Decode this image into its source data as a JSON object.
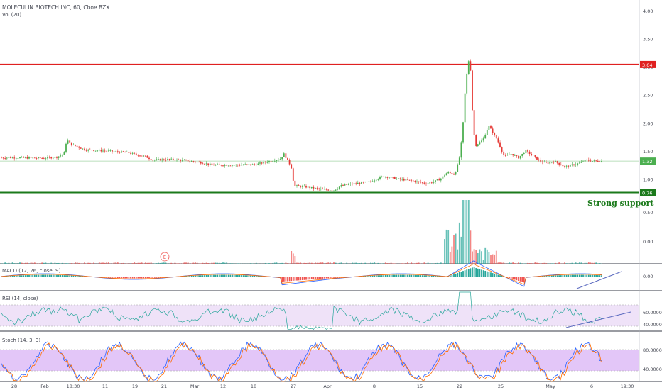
{
  "header": {
    "symbol_line": "MOLECULIN BIOTECH INC, 60, Cboe BZX",
    "volume_label": "Vol (20)",
    "macd_label": "MACD (12, 26, close, 9)",
    "rsi_label": "RSI (14, close)",
    "stoch_label": "Stoch (14, 3, 3)"
  },
  "annotations": {
    "strong_support_text": "Strong support",
    "earnings_marker": "E"
  },
  "colors": {
    "up": "#26a69a",
    "down": "#ef5350",
    "candle_up": "#4caf50",
    "candle_down": "#e53935",
    "resistance_line": "#e02020",
    "support_line": "#1b7a1b",
    "current_price_line": "#a5d6a7",
    "rsi_band": "#e8d5f5",
    "stoch_band": "#d9b3f5",
    "macd_line": "#2962ff",
    "signal_line": "#ff6d00",
    "osc_line": "#26a69a",
    "trendline": "#5c6bc0"
  },
  "chart_data": [
    {
      "type": "candlestick",
      "title": "MOLECULIN BIOTECH INC, 60, Cboe BZX",
      "ylim": [
        0.64,
        4.15
      ],
      "y_ticks": [
        "4.00",
        "3.50",
        "3.00",
        "2.50",
        "2.00",
        "1.50",
        "1.00"
      ],
      "x_ticks": [
        "28",
        "Feb",
        "18:30",
        "11",
        "19",
        "21",
        "Mar",
        "12",
        "18",
        "27",
        "Apr",
        "8",
        "15",
        "22",
        "25",
        "May",
        "6",
        "19:30"
      ],
      "horizontal_lines": [
        {
          "value": 3.04,
          "label": "3.04",
          "role": "resistance"
        },
        {
          "value": 0.76,
          "label": "0.76",
          "role": "support"
        },
        {
          "value": 1.32,
          "label": "1.32",
          "role": "last price"
        }
      ],
      "price_path": [
        [
          0,
          1.38
        ],
        [
          30,
          1.38
        ],
        [
          60,
          1.37
        ],
        [
          80,
          1.39
        ],
        [
          90,
          1.45
        ],
        [
          94,
          1.7
        ],
        [
          100,
          1.62
        ],
        [
          120,
          1.52
        ],
        [
          150,
          1.5
        ],
        [
          180,
          1.47
        ],
        [
          205,
          1.4
        ],
        [
          215,
          1.34
        ],
        [
          240,
          1.35
        ],
        [
          260,
          1.33
        ],
        [
          280,
          1.3
        ],
        [
          300,
          1.25
        ],
        [
          330,
          1.25
        ],
        [
          360,
          1.26
        ],
        [
          380,
          1.32
        ],
        [
          395,
          1.36
        ],
        [
          400,
          1.45
        ],
        [
          404,
          1.35
        ],
        [
          410,
          1.22
        ],
        [
          414,
          0.88
        ],
        [
          430,
          0.86
        ],
        [
          450,
          0.82
        ],
        [
          470,
          0.8
        ],
        [
          480,
          0.88
        ],
        [
          500,
          0.92
        ],
        [
          520,
          0.95
        ],
        [
          540,
          1.05
        ],
        [
          560,
          1.0
        ],
        [
          580,
          0.97
        ],
        [
          600,
          0.92
        ],
        [
          610,
          0.95
        ],
        [
          620,
          1.0
        ],
        [
          630,
          1.12
        ],
        [
          640,
          1.08
        ],
        [
          645,
          1.28
        ],
        [
          648,
          1.45
        ],
        [
          652,
          2.0
        ],
        [
          655,
          2.6
        ],
        [
          658,
          2.95
        ],
        [
          660,
          3.12
        ],
        [
          663,
          2.9
        ],
        [
          666,
          1.9
        ],
        [
          670,
          1.6
        ],
        [
          680,
          1.7
        ],
        [
          688,
          1.95
        ],
        [
          695,
          1.8
        ],
        [
          700,
          1.7
        ],
        [
          710,
          1.4
        ],
        [
          720,
          1.45
        ],
        [
          730,
          1.38
        ],
        [
          740,
          1.5
        ],
        [
          750,
          1.42
        ],
        [
          760,
          1.32
        ],
        [
          770,
          1.28
        ],
        [
          780,
          1.32
        ],
        [
          795,
          1.22
        ],
        [
          805,
          1.25
        ],
        [
          815,
          1.28
        ],
        [
          825,
          1.34
        ],
        [
          835,
          1.32
        ],
        [
          848,
          1.32
        ]
      ]
    },
    {
      "type": "bar",
      "title": "Vol (20)",
      "y_ticks": [
        "0.50",
        "0.00"
      ]
    },
    {
      "type": "line",
      "title": "MACD (12, 26, close, 9)",
      "y_ticks": [
        "0.00"
      ]
    },
    {
      "type": "line",
      "title": "RSI (14, close)",
      "y_ticks": [
        "60.0000",
        "40.0000"
      ]
    },
    {
      "type": "line",
      "title": "Stoch (14, 3, 3)",
      "y_ticks": [
        "80.0000",
        "40.0000"
      ]
    }
  ]
}
